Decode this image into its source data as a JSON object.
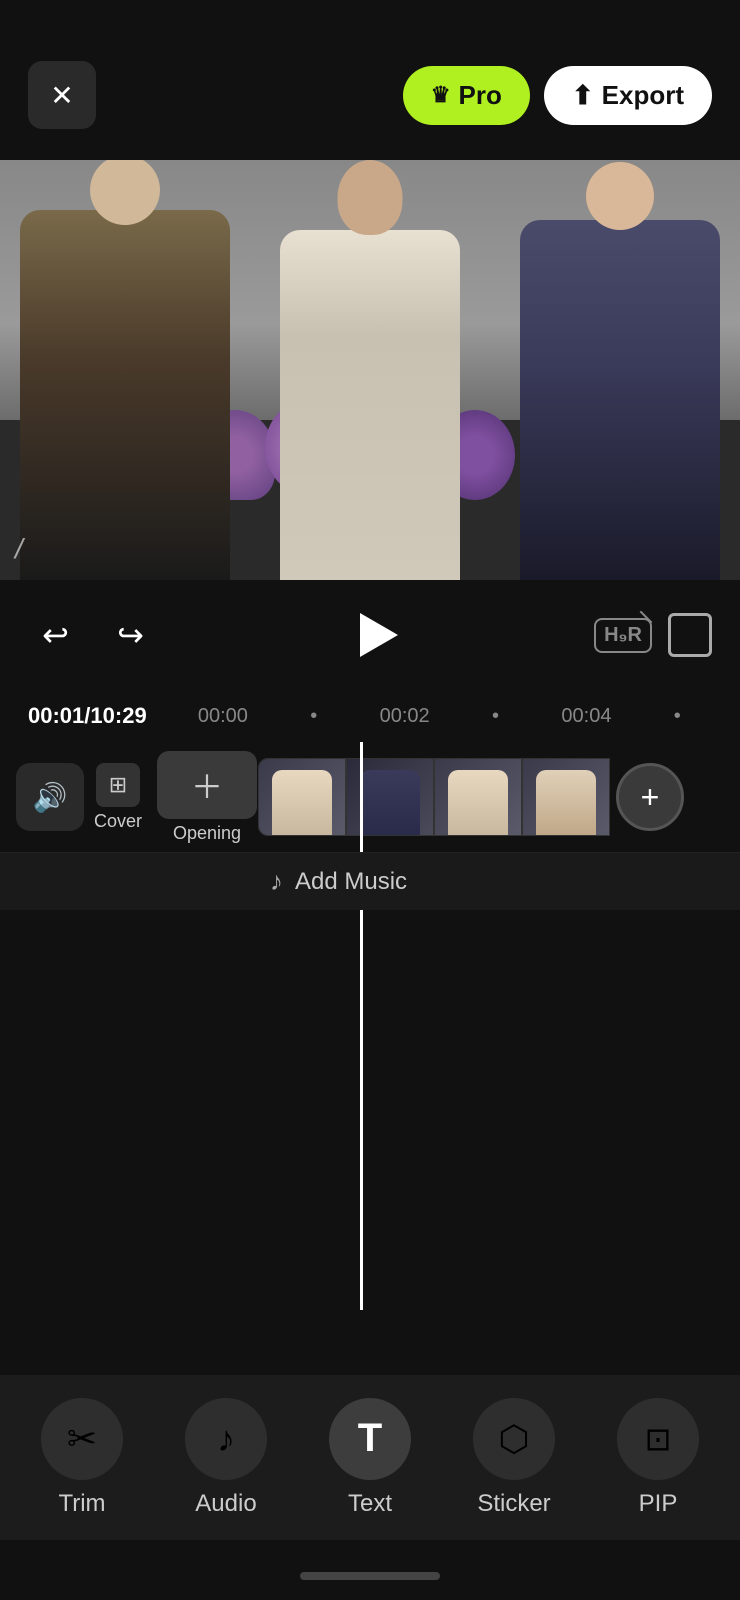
{
  "header": {
    "pro_label": "Pro",
    "export_label": "Export"
  },
  "controls": {
    "time_current": "00:01",
    "time_total": "10:29",
    "time_marker1": "00:00",
    "time_marker2": "00:02",
    "time_marker3": "00:04"
  },
  "track": {
    "cover_label": "Cover",
    "opening_label": "Opening",
    "add_music_label": "Add Music"
  },
  "toolbar": {
    "trim_label": "Trim",
    "audio_label": "Audio",
    "text_label": "Text",
    "sticker_label": "Sticker",
    "pip_label": "PIP"
  }
}
